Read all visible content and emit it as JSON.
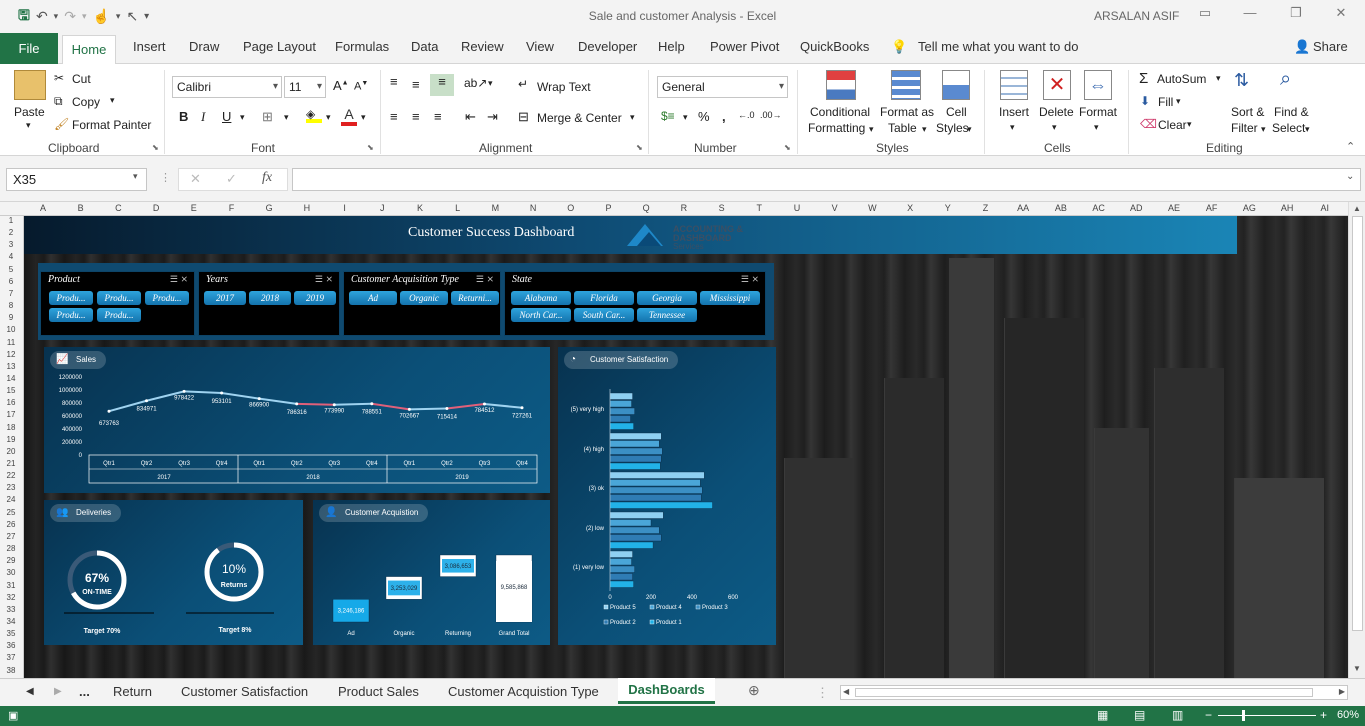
{
  "window": {
    "doc_title": "Sale and customer Analysis  -  Excel",
    "user": "ARSALAN ASIF"
  },
  "ribbon_tabs": {
    "file": "File",
    "home": "Home",
    "insert": "Insert",
    "draw": "Draw",
    "page_layout": "Page Layout",
    "formulas": "Formulas",
    "data": "Data",
    "review": "Review",
    "view": "View",
    "developer": "Developer",
    "help": "Help",
    "power_pivot": "Power Pivot",
    "quickbooks": "QuickBooks",
    "tell_me": "Tell me what you want to do",
    "share": "Share"
  },
  "ribbon": {
    "paste": "Paste",
    "cut": "Cut",
    "copy": "Copy",
    "format_painter": "Format Painter",
    "clipboard": "Clipboard",
    "font_name": "Calibri",
    "font_size": "11",
    "font": "Font",
    "wrap_text": "Wrap Text",
    "merge_center": "Merge & Center",
    "alignment": "Alignment",
    "number_format": "General",
    "number": "Number",
    "conditional_formatting_1": "Conditional",
    "conditional_formatting_2": "Formatting",
    "format_as_table_1": "Format as",
    "format_as_table_2": "Table",
    "cell_styles_1": "Cell",
    "cell_styles_2": "Styles",
    "styles": "Styles",
    "insert": "Insert",
    "delete": "Delete",
    "format": "Format",
    "cells": "Cells",
    "autosum": "AutoSum",
    "fill": "Fill",
    "clear": "Clear",
    "sort_filter_1": "Sort &",
    "sort_filter_2": "Filter",
    "find_select_1": "Find &",
    "find_select_2": "Select",
    "editing": "Editing"
  },
  "formula_bar": {
    "name_box": "X35",
    "fx": "fx",
    "formula": ""
  },
  "columns": [
    "A",
    "B",
    "C",
    "D",
    "E",
    "F",
    "G",
    "H",
    "I",
    "J",
    "K",
    "L",
    "M",
    "N",
    "O",
    "P",
    "Q",
    "R",
    "S",
    "T",
    "U",
    "V",
    "W",
    "X",
    "Y",
    "Z",
    "AA",
    "AB",
    "AC",
    "AD",
    "AE",
    "AF",
    "AG",
    "AH",
    "AI"
  ],
  "rows": [
    "1",
    "2",
    "3",
    "4",
    "5",
    "6",
    "7",
    "8",
    "9",
    "10",
    "11",
    "12",
    "13",
    "14",
    "15",
    "16",
    "17",
    "18",
    "19",
    "20",
    "21",
    "22",
    "23",
    "24",
    "25",
    "26",
    "27",
    "28",
    "29",
    "30",
    "31",
    "32",
    "33",
    "34",
    "35",
    "36",
    "37",
    "38"
  ],
  "dashboard": {
    "title": "Customer Success Dashboard",
    "logo_line1": "ACCOUNTING &",
    "logo_line2": "DASHBOARD",
    "logo_line3": "Services",
    "slicers": [
      {
        "title": "Product",
        "items": [
          "Produ...",
          "Produ...",
          "Produ...",
          "Produ...",
          "Produ..."
        ]
      },
      {
        "title": "Years",
        "items": [
          "2017",
          "2018",
          "2019"
        ]
      },
      {
        "title": "Customer Acquisition Type",
        "items": [
          "Ad",
          "Organic",
          "Returni..."
        ]
      },
      {
        "title": "State",
        "items": [
          "Alabama",
          "Florida",
          "Georgia",
          "Mississippi",
          "North Car...",
          "South Car...",
          "Tennessee"
        ]
      }
    ],
    "sales_label": "Sales",
    "satisfaction_label": "Customer Satisfaction",
    "deliveries_label": "Deliveries",
    "acquisition_label": "Customer Acquistion",
    "ontime_value": "67%",
    "ontime_text": "ON-TIME",
    "returns_value": "10%",
    "returns_text": "Returns",
    "target_ontime": "Target 70%",
    "target_returns": "Target 8%"
  },
  "chart_data": [
    {
      "type": "line",
      "title": "Sales",
      "categories": [
        "Qtr1",
        "Qtr2",
        "Qtr3",
        "Qtr4",
        "Qtr1",
        "Qtr2",
        "Qtr3",
        "Qtr4",
        "Qtr1",
        "Qtr2",
        "Qtr3",
        "Qtr4"
      ],
      "groups": [
        "2017",
        "2018",
        "2019"
      ],
      "values": [
        673763,
        834971,
        978422,
        953101,
        866900,
        786316,
        773990,
        788551,
        702667,
        715414,
        784512,
        727261
      ],
      "ylim": [
        0,
        1200000
      ],
      "yticks": [
        "1200000",
        "1000000",
        "800000",
        "600000",
        "400000",
        "200000",
        "0"
      ],
      "line_colors": [
        "#9fd3f0",
        "#e0607a"
      ]
    },
    {
      "type": "bar",
      "title": "Customer Satisfaction",
      "orientation": "horizontal",
      "categories": [
        "(5) very high",
        "(4) high",
        "(3) ok",
        "(2) low",
        "(1) very low"
      ],
      "series": [
        {
          "name": "Product 5",
          "values": [
            110,
            250,
            460,
            260,
            110
          ]
        },
        {
          "name": "Product 4",
          "values": [
            105,
            240,
            440,
            200,
            105
          ]
        },
        {
          "name": "Product 3",
          "values": [
            120,
            255,
            450,
            240,
            120
          ]
        },
        {
          "name": "Product 2",
          "values": [
            100,
            250,
            445,
            250,
            110
          ]
        },
        {
          "name": "Product 1",
          "values": [
            115,
            245,
            500,
            210,
            115
          ]
        }
      ],
      "xticks": [
        "0",
        "200",
        "400",
        "600"
      ],
      "xlim": [
        0,
        700
      ],
      "colors": [
        "#8fd0f2",
        "#4aa6d8",
        "#3b8fc4",
        "#2f7cb4",
        "#22b2e8"
      ]
    },
    {
      "type": "waterfall",
      "title": "Customer Acquistion",
      "categories": [
        "Ad",
        "Organic",
        "Returning",
        "Grand Total"
      ],
      "values": [
        3246186,
        3253029,
        3086653,
        9585868
      ],
      "labels": [
        "3,246,186",
        "3,253,029",
        "3,086,653",
        "9,585,868"
      ]
    }
  ],
  "sheet_tabs": {
    "ellipsis": "...",
    "return": "Return",
    "customer_satisfaction": "Customer Satisfaction",
    "product_sales": "Product Sales",
    "customer_acquisition_type": "Customer Acquistion Type",
    "dashboards": "DashBoards"
  },
  "status": {
    "zoom": "60%"
  }
}
